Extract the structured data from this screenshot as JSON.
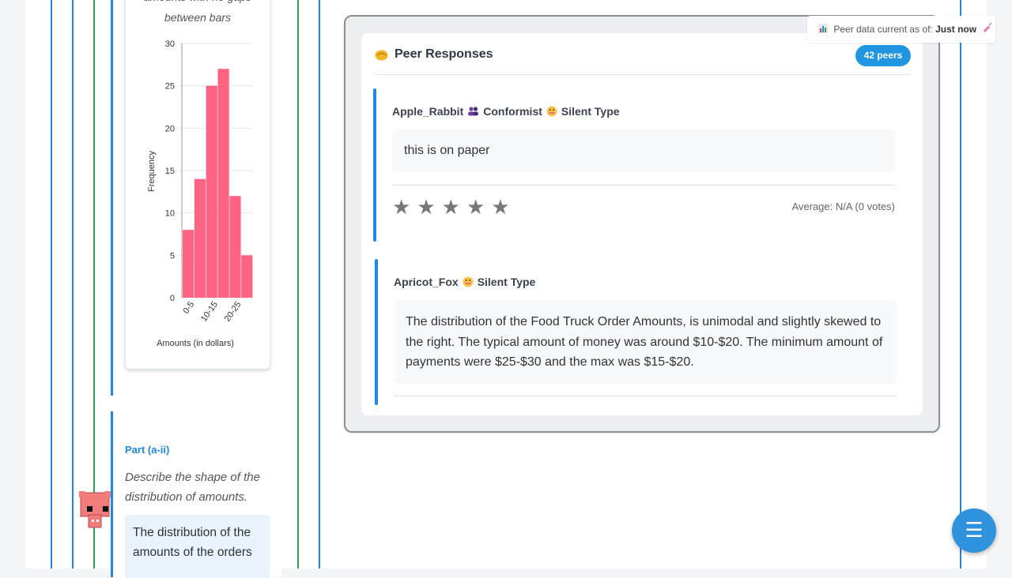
{
  "left_column": {
    "chart_caption": [
      "amounts with no gaps",
      "between bars"
    ],
    "part_label": "Part (a-ii)",
    "prompt": "Describe the shape of the distribution of amounts.",
    "answer_excerpt": "The distribution of the amounts of the orders"
  },
  "chart_data": {
    "type": "bar",
    "title": "",
    "xlabel": "Amounts (in dollars)",
    "ylabel": "Frequency",
    "ylim": [
      0,
      30
    ],
    "yticks": [
      0,
      5,
      10,
      15,
      20,
      25,
      30
    ],
    "xtick_labels": [
      "0-5",
      "10-15",
      "20-25"
    ],
    "bars": [
      8,
      14,
      25,
      27,
      12,
      5
    ],
    "bar_color": "#ff6384",
    "grid": true
  },
  "peer_panel": {
    "title": "Peer Responses",
    "peers_badge": "42 peers",
    "status_prefix": "Peer data current as of:",
    "status_value": "Just now"
  },
  "responses": [
    {
      "user": "Apple_Rabbit",
      "tags": [
        "Conformist",
        "Silent Type"
      ],
      "text": "this is on paper",
      "rating_label": "Average: N/A (0 votes)"
    },
    {
      "user": "Apricot_Fox",
      "tags": [
        "Silent Type"
      ],
      "text": "The distribution of the Food Truck Order Amounts, is unimodal and slightly skewed to the right. The typical amount of money was around $10-$20. The minimum amount of payments were $25-$30 and the max was $15-$20."
    }
  ],
  "fab_icon": "menu-icon",
  "colors": {
    "accent": "#1e88e5",
    "badge": "#2196e0",
    "bars": "#ff6384"
  }
}
